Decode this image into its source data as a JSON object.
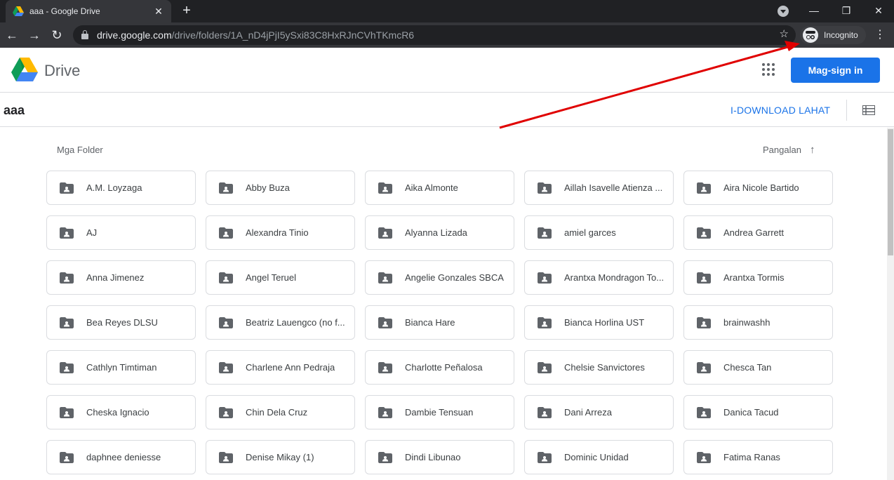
{
  "browser": {
    "tab_title": "aaa - Google Drive",
    "url_domain": "drive.google.com",
    "url_path": "/drive/folders/1A_nD4jPjI5ySxi83C8HxRJnCVhTKmcR6",
    "incognito_label": "Incognito"
  },
  "header": {
    "brand": "Drive",
    "signin_label": "Mag-sign in"
  },
  "subheader": {
    "folder_title": "aaa",
    "download_label": "I-DOWNLOAD LAHAT"
  },
  "main": {
    "section_label": "Mga Folder",
    "sort_label": "Pangalan",
    "folders": [
      "A.M. Loyzaga",
      "Abby Buza",
      "Aika Almonte",
      "Aillah Isavelle Atienza ...",
      "Aira Nicole Bartido",
      "AJ",
      "Alexandra Tinio",
      "Alyanna Lizada",
      "amiel garces",
      "Andrea Garrett",
      "Anna Jimenez",
      "Angel Teruel",
      "Angelie Gonzales SBCA",
      "Arantxa Mondragon To...",
      "Arantxa Tormis",
      "Bea Reyes DLSU",
      "Beatriz Lauengco (no f...",
      "Bianca Hare",
      "Bianca Horlina UST",
      "brainwashh",
      "Cathlyn Timtiman",
      "Charlene Ann Pedraja",
      "Charlotte Peñalosa",
      "Chelsie Sanvictores",
      "Chesca Tan",
      "Cheska Ignacio",
      "Chin Dela Cruz",
      "Dambie Tensuan",
      "Dani Arreza",
      "Danica Tacud",
      "daphnee deniesse",
      "Denise Mikay (1)",
      "Dindi Libunao",
      "Dominic Unidad",
      "Fatima Ranas"
    ]
  },
  "colors": {
    "accent": "#1a73e8",
    "annotation_arrow": "#e00000",
    "folder_icon": "#5f6368"
  }
}
